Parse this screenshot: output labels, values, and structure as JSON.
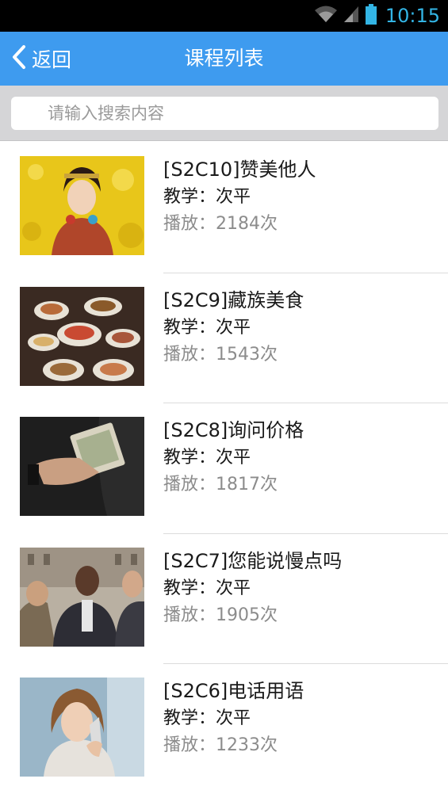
{
  "status_bar": {
    "time": "10:15",
    "icons": [
      "wifi-icon",
      "signal-icon",
      "battery-icon"
    ],
    "time_color": "#33b5e5"
  },
  "app_bar": {
    "back_label": "返回",
    "title": "课程列表",
    "background": "#3e9bef"
  },
  "search": {
    "placeholder": "请输入搜索内容"
  },
  "courses": [
    {
      "title": "[S2C10]赞美他人",
      "teacher": "教学：次平",
      "plays": "播放：2184次",
      "thumbnail": "woman-in-flower-field"
    },
    {
      "title": "[S2C9]藏族美食",
      "teacher": "教学：次平",
      "plays": "播放：1543次",
      "thumbnail": "tibetan-food-table"
    },
    {
      "title": "[S2C8]询问价格",
      "teacher": "教学：次平",
      "plays": "播放：1817次",
      "thumbnail": "hand-with-money"
    },
    {
      "title": "[S2C7]您能说慢点吗",
      "teacher": "教学：次平",
      "plays": "播放：1905次",
      "thumbnail": "men-talking-street"
    },
    {
      "title": "[S2C6]电话用语",
      "teacher": "教学：次平",
      "plays": "播放：1233次",
      "thumbnail": "woman-on-phone"
    }
  ]
}
